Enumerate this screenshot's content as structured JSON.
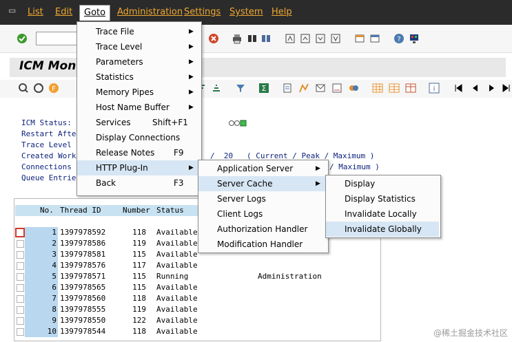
{
  "menubar": {
    "items": [
      {
        "label": "List"
      },
      {
        "label": "Edit"
      },
      {
        "label": "Goto"
      },
      {
        "label": "Administration"
      },
      {
        "label": "Settings"
      },
      {
        "label": "System"
      },
      {
        "label": "Help"
      }
    ]
  },
  "page": {
    "title": "ICM Moni"
  },
  "status": {
    "lines": [
      "ICM Status:",
      "Restart Afte",
      "Trace Level",
      "Created Work",
      "Connections",
      "Queue Entrie"
    ],
    "created_frag": "/  20   ( Current / Peak / Maximum )",
    "connections_frag": "/ Maximum )"
  },
  "table": {
    "headers": {
      "no": "No.",
      "thread": "Thread ID",
      "number": "Number",
      "status": "Status"
    },
    "rows": [
      {
        "no": "1",
        "thread": "1397978592",
        "number": "118",
        "status": "Available",
        "extra": ""
      },
      {
        "no": "2",
        "thread": "1397978586",
        "number": "119",
        "status": "Available",
        "extra": ""
      },
      {
        "no": "3",
        "thread": "1397978581",
        "number": "115",
        "status": "Available",
        "extra": ""
      },
      {
        "no": "4",
        "thread": "1397978576",
        "number": "117",
        "status": "Available",
        "extra": ""
      },
      {
        "no": "5",
        "thread": "1397978571",
        "number": "115",
        "status": "Running",
        "extra": "Administration"
      },
      {
        "no": "6",
        "thread": "1397978565",
        "number": "115",
        "status": "Available",
        "extra": ""
      },
      {
        "no": "7",
        "thread": "1397978560",
        "number": "118",
        "status": "Available",
        "extra": ""
      },
      {
        "no": "8",
        "thread": "1397978555",
        "number": "119",
        "status": "Available",
        "extra": ""
      },
      {
        "no": "9",
        "thread": "1397978550",
        "number": "122",
        "status": "Available",
        "extra": ""
      },
      {
        "no": "10",
        "thread": "1397978544",
        "number": "118",
        "status": "Available",
        "extra": ""
      }
    ]
  },
  "goto_menu": {
    "items": [
      {
        "label": "Trace File",
        "shortcut": "",
        "submenu": true
      },
      {
        "label": "Trace Level",
        "shortcut": "",
        "submenu": true
      },
      {
        "label": "Parameters",
        "shortcut": "",
        "submenu": true
      },
      {
        "label": "Statistics",
        "shortcut": "",
        "submenu": true
      },
      {
        "label": "Memory Pipes",
        "shortcut": "",
        "submenu": true
      },
      {
        "label": "Host Name Buffer",
        "shortcut": "",
        "submenu": true
      },
      {
        "label": "Services",
        "shortcut": "Shift+F1",
        "submenu": false
      },
      {
        "label": "Display Connections",
        "shortcut": "",
        "submenu": false
      },
      {
        "label": "Release Notes",
        "shortcut": "F9",
        "submenu": false
      },
      {
        "label": "HTTP Plug-In",
        "shortcut": "",
        "submenu": true
      },
      {
        "label": "Back",
        "shortcut": "F3",
        "submenu": false
      }
    ]
  },
  "http_menu": {
    "items": [
      {
        "label": "Application Server",
        "submenu": true
      },
      {
        "label": "Server Cache",
        "submenu": true
      },
      {
        "label": "Server Logs",
        "submenu": false
      },
      {
        "label": "Client Logs",
        "submenu": false
      },
      {
        "label": "Authorization Handler",
        "submenu": false
      },
      {
        "label": "Modification Handler",
        "submenu": false
      }
    ]
  },
  "cache_menu": {
    "items": [
      {
        "label": "Display"
      },
      {
        "label": "Display Statistics"
      },
      {
        "label": "Invalidate Locally"
      },
      {
        "label": "Invalidate Globally"
      }
    ]
  },
  "watermark": "@稀土掘金技术社区",
  "colors": {
    "menubar": "#2b2b2b",
    "menu_text": "#f0a830",
    "highlight": "#d7e6f4",
    "status_text": "#0a1f7a"
  }
}
